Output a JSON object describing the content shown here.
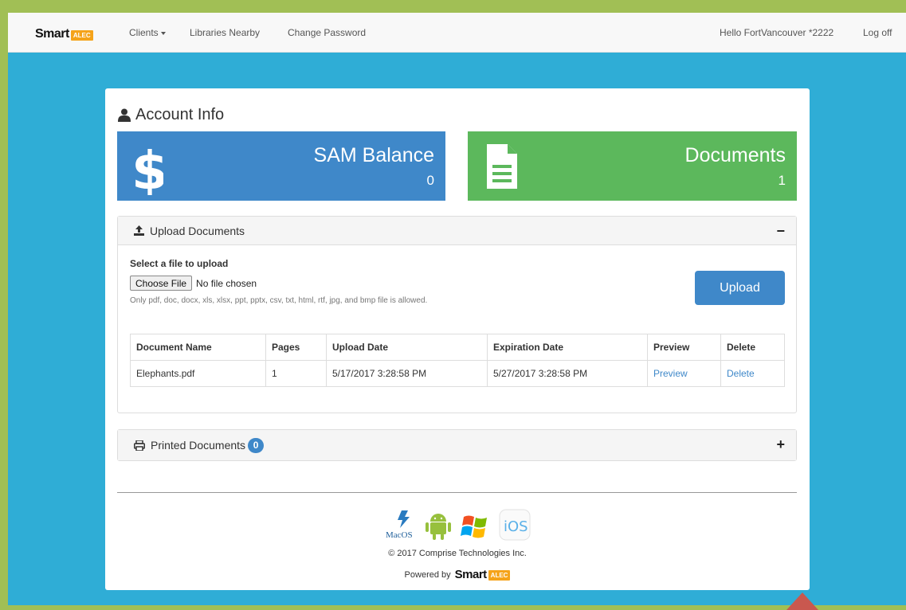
{
  "navbar": {
    "brand_smart": "Smart",
    "brand_alec": "ALEC",
    "links": {
      "clients": "Clients",
      "libraries": "Libraries Nearby",
      "password": "Change Password"
    },
    "greeting": "Hello FortVancouver *2222",
    "logoff": "Log off"
  },
  "account": {
    "title": "Account Info",
    "sam_balance": {
      "label": "SAM Balance",
      "value": "0"
    },
    "documents": {
      "label": "Documents",
      "value": "1"
    }
  },
  "upload_panel": {
    "title": "Upload Documents",
    "toggle": "−",
    "select_label": "Select a file to upload",
    "choose_file": "Choose File",
    "no_file": "No file chosen",
    "allowed": "Only pdf, doc, docx, xls, xlsx, ppt, pptx, csv, txt, html, rtf, jpg, and bmp file is allowed.",
    "upload_button": "Upload",
    "table": {
      "headers": [
        "Document Name",
        "Pages",
        "Upload Date",
        "Expiration Date",
        "Preview",
        "Delete"
      ],
      "rows": [
        {
          "name": "Elephants.pdf",
          "pages": "1",
          "upload_date": "5/17/2017 3:28:58 PM",
          "expiration_date": "5/27/2017 3:28:58 PM",
          "preview": "Preview",
          "delete": "Delete"
        }
      ]
    }
  },
  "printed_panel": {
    "title": "Printed Documents",
    "count": "0",
    "toggle": "+"
  },
  "footer": {
    "ios_label": "iOS",
    "mac_label": "MacOS",
    "copyright": "© 2017 Comprise Technologies Inc.",
    "powered_by": "Powered by"
  },
  "colors": {
    "frame": "#2fadd6",
    "outer": "#a1bf55",
    "blue": "#3f88c9",
    "green": "#5cb85c",
    "accent_orange": "#f5a31a"
  }
}
